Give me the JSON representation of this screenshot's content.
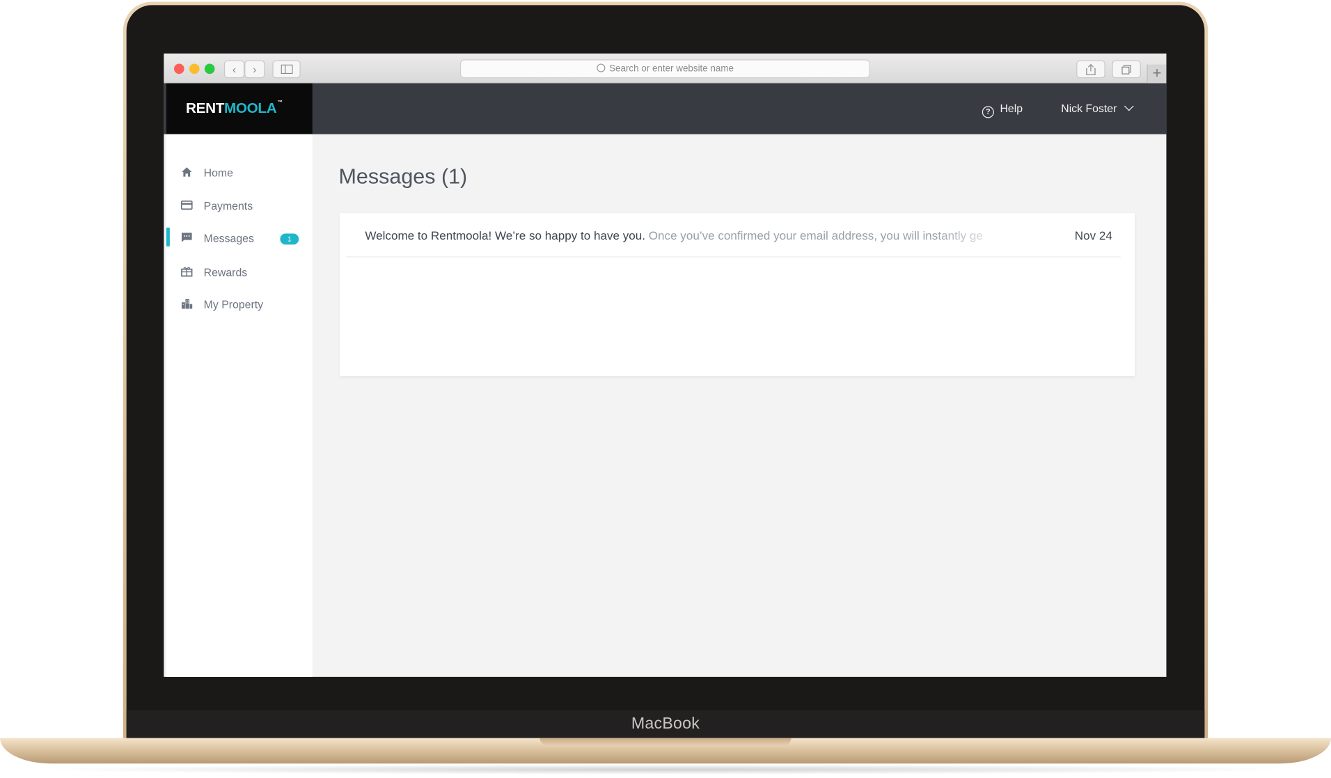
{
  "device": {
    "label": "MacBook"
  },
  "browser": {
    "address_placeholder": "Search or enter website name",
    "back_glyph": "‹",
    "forward_glyph": "›",
    "new_tab_glyph": "+"
  },
  "brand": {
    "logo_part1": "RENT",
    "logo_part2": "MOOLA",
    "trademark": "™",
    "accent": "#1fb6c9"
  },
  "header": {
    "help_label": "Help",
    "help_glyph": "?",
    "user_name": "Nick Foster"
  },
  "sidebar": {
    "items": [
      {
        "label": "Home",
        "icon": "home-icon"
      },
      {
        "label": "Payments",
        "icon": "credit-card-icon"
      },
      {
        "label": "Messages",
        "icon": "chat-icon",
        "badge": "1",
        "active": true
      },
      {
        "label": "Rewards",
        "icon": "gift-icon"
      },
      {
        "label": "My Property",
        "icon": "building-icon"
      }
    ]
  },
  "main": {
    "title": "Messages (1)",
    "messages": [
      {
        "subject": "Welcome to Rentmoola! We’re so happy to have you.",
        "preview": " Once you’ve confirmed your email address, you will instantly ge",
        "date": "Nov 24"
      }
    ]
  }
}
